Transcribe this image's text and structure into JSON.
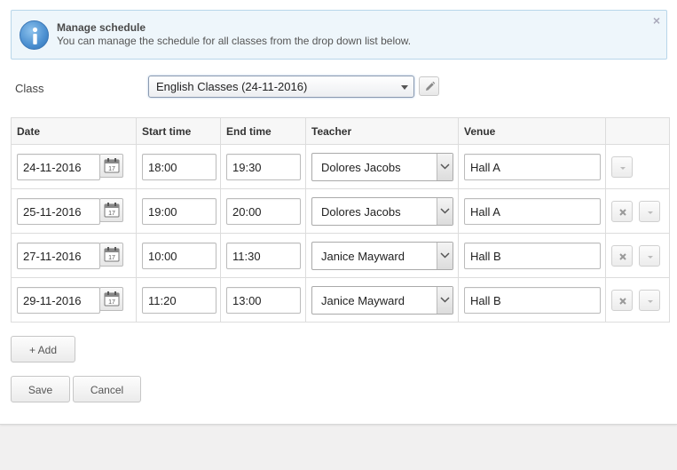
{
  "info": {
    "title": "Manage schedule",
    "text": "You can manage the schedule for all classes from the drop down list below.",
    "close_glyph": "×"
  },
  "class_field": {
    "label": "Class",
    "selected": "English Classes (24-11-2016)"
  },
  "table": {
    "headers": {
      "date": "Date",
      "start": "Start time",
      "end": "End time",
      "teacher": "Teacher",
      "venue": "Venue"
    },
    "rows": [
      {
        "date": "24-11-2016",
        "start": "18:00",
        "end": "19:30",
        "teacher": "Dolores Jacobs",
        "venue": "Hall A",
        "removable": false
      },
      {
        "date": "25-11-2016",
        "start": "19:00",
        "end": "20:00",
        "teacher": "Dolores Jacobs",
        "venue": "Hall A",
        "removable": true
      },
      {
        "date": "27-11-2016",
        "start": "10:00",
        "end": "11:30",
        "teacher": "Janice Mayward",
        "venue": "Hall B",
        "removable": true
      },
      {
        "date": "29-11-2016",
        "start": "11:20",
        "end": "13:00",
        "teacher": "Janice Mayward",
        "venue": "Hall B",
        "removable": true
      }
    ]
  },
  "calendar_icon_day": "17",
  "buttons": {
    "add": "+ Add",
    "save": "Save",
    "cancel": "Cancel"
  },
  "colors": {
    "info_bg": "#eef6fb",
    "info_border": "#b8d6ea",
    "info_icon": "#4b8fd0",
    "page_bg": "#f1f0f0"
  }
}
